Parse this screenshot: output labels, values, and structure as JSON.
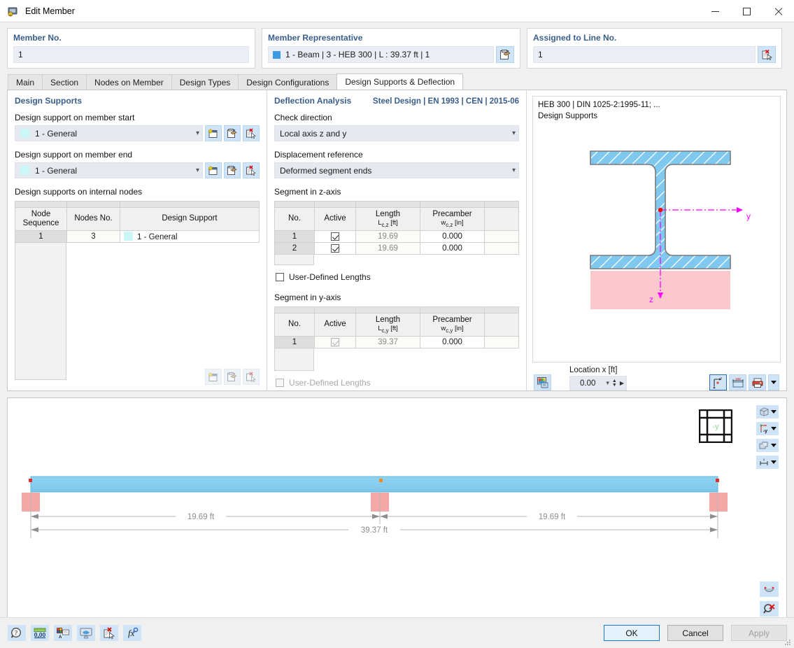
{
  "window": {
    "title": "Edit Member",
    "icon": "member-icon",
    "minimize": "minimize-icon",
    "maximize": "maximize-icon",
    "close": "close-icon"
  },
  "top": {
    "member_no": {
      "label": "Member No.",
      "value": "1"
    },
    "member_representative": {
      "label": "Member Representative",
      "value": "1 - Beam | 3 - HEB 300 | L : 39.37 ft | 1",
      "swatch_color": "#3b9ae1",
      "button_icon": "edit-member-icon"
    },
    "assigned_line": {
      "label": "Assigned to Line No.",
      "value": "1",
      "button_icon": "pick-line-icon"
    }
  },
  "tabs": [
    {
      "label": "Main",
      "active": false
    },
    {
      "label": "Section",
      "active": false
    },
    {
      "label": "Nodes on Member",
      "active": false
    },
    {
      "label": "Design Types",
      "active": false
    },
    {
      "label": "Design Configurations",
      "active": false
    },
    {
      "label": "Design Supports & Deflection",
      "active": true
    }
  ],
  "design_supports": {
    "section_title": "Design Supports",
    "start_label": "Design support on member start",
    "start_value": "1 - General",
    "end_label": "Design support on member end",
    "end_value": "1 - General",
    "swatch_color": "#ccf7f7",
    "buttons": [
      "new-icon",
      "edit-icon",
      "pick-icon"
    ],
    "internal_label": "Design supports on internal nodes",
    "table": {
      "headers": [
        "Node Sequence",
        "Nodes No.",
        "Design Support"
      ],
      "rows": [
        {
          "sequence": "1",
          "node_no": "3",
          "support": "1 - General"
        }
      ]
    }
  },
  "deflection": {
    "section_title": "Deflection Analysis",
    "standard": "Steel Design | EN 1993 | CEN | 2015-06",
    "check_direction_label": "Check direction",
    "check_direction_value": "Local axis z and y",
    "displacement_reference_label": "Displacement reference",
    "displacement_reference_value": "Deformed segment ends",
    "segment_z": {
      "title": "Segment in z-axis",
      "headers": [
        "No.",
        "Active",
        "Length",
        "Precamber"
      ],
      "subheaders": [
        "",
        "",
        "Lc,z [ft]",
        "wc,z [in]"
      ],
      "rows": [
        {
          "no": "1",
          "active": true,
          "length": "19.69",
          "precamber": "0.000"
        },
        {
          "no": "2",
          "active": true,
          "length": "19.69",
          "precamber": "0.000"
        }
      ],
      "user_defined_label": "User-Defined Lengths",
      "user_defined_checked": false,
      "user_defined_disabled": false
    },
    "segment_y": {
      "title": "Segment in y-axis",
      "headers": [
        "No.",
        "Active",
        "Length",
        "Precamber"
      ],
      "subheaders": [
        "",
        "",
        "Lc,y [ft]",
        "wc,y [in]"
      ],
      "rows": [
        {
          "no": "1",
          "active": true,
          "length": "39.37",
          "precamber": "0.000"
        }
      ],
      "user_defined_label": "User-Defined Lengths",
      "user_defined_checked": false,
      "user_defined_disabled": true
    }
  },
  "section_view": {
    "caption_line1": "HEB 300 | DIN 1025-2:1995-11; ...",
    "caption_line2": "Design Supports",
    "axis_y_label": "y",
    "axis_z_label": "z",
    "colors": {
      "section_fill": "#7fc8ef",
      "section_outline": "#808080",
      "support_fill": "#f8c8cc",
      "axis": "#ff00ff"
    },
    "location_label": "Location x [ft]",
    "location_value": "0.00",
    "render_button_icon": "render-image-icon",
    "toolbar_buttons": [
      "axis-system-icon",
      "dimensions-icon",
      "print-icon",
      "print-dropdown-icon"
    ]
  },
  "view3d": {
    "beam_color": "#8fd2f0",
    "support_color": "#f4a7a7",
    "dim_inner_left": "19.69 ft",
    "dim_inner_right": "19.69 ft",
    "dim_total": "39.37 ft",
    "viewcube_label": "-y",
    "toolbar_buttons": [
      "view-mode-icon",
      "axis-view-icon",
      "render-mode-icon",
      "dimension-icon"
    ],
    "bottom_buttons": [
      "smile-select-icon",
      "zoom-reset-icon"
    ]
  },
  "footer": {
    "icons": [
      "help-icon",
      "units-icon",
      "display-properties-icon",
      "view-icon",
      "pick-icon",
      "formula-icon"
    ],
    "ok": "OK",
    "cancel": "Cancel",
    "apply": "Apply"
  }
}
